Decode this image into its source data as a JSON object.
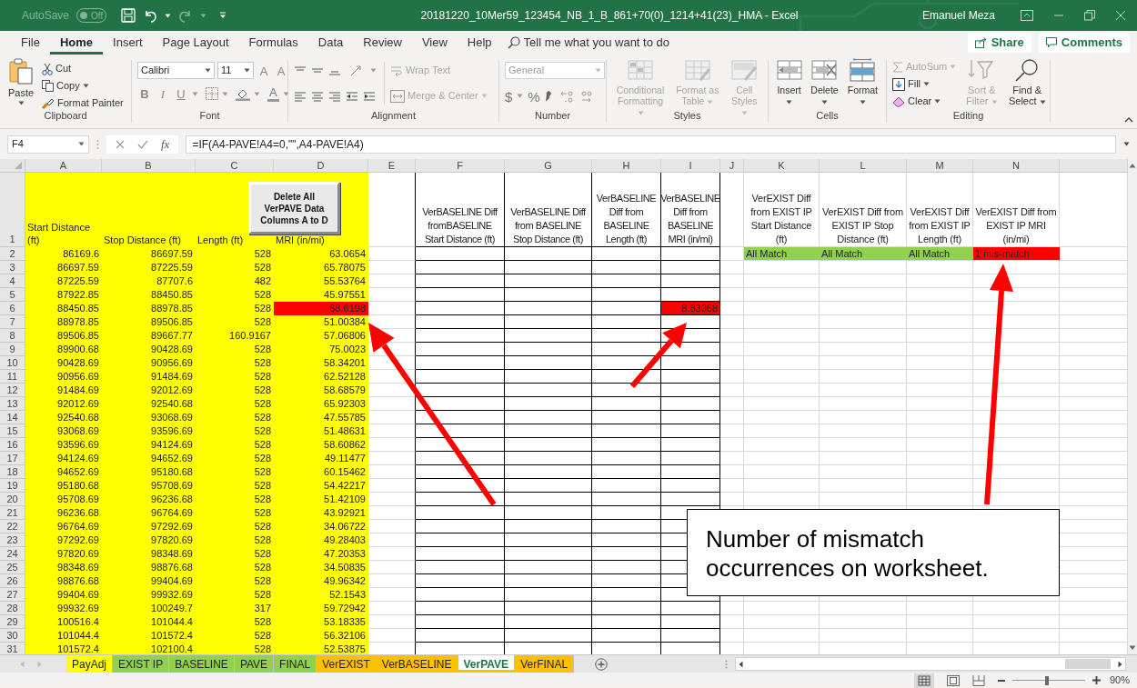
{
  "title_bar": {
    "autosave_label": "AutoSave",
    "autosave_state": "Off",
    "autosave_on": false,
    "document_title": "20181220_10Mer59_123454_NB_1_B_861+70(0)_1214+41(23)_HMA  -  Excel",
    "user": "Emanuel Meza"
  },
  "menu_tabs": [
    {
      "label": "File",
      "selected": false
    },
    {
      "label": "Home",
      "selected": true
    },
    {
      "label": "Insert",
      "selected": false
    },
    {
      "label": "Page Layout",
      "selected": false
    },
    {
      "label": "Formulas",
      "selected": false
    },
    {
      "label": "Data",
      "selected": false
    },
    {
      "label": "Review",
      "selected": false
    },
    {
      "label": "View",
      "selected": false
    },
    {
      "label": "Help",
      "selected": false
    }
  ],
  "tell_me": {
    "placeholder": "Tell me what you want to do"
  },
  "share": "Share",
  "comments": "Comments",
  "ribbon": [
    {
      "kind": "clipboard",
      "label": "Clipboard",
      "paste": "Paste",
      "cut": "Cut",
      "copy": "Copy",
      "format_painter": "Format Painter"
    },
    {
      "kind": "font",
      "label": "Font",
      "font_name": "Calibri",
      "font_size": "11",
      "grow": "A",
      "shrink": "A",
      "bold": "B",
      "italic": "I",
      "underline": "U",
      "font_color": "A"
    },
    {
      "kind": "alignment",
      "label": "Alignment",
      "items": [
        {
          "label": "Wrap Text",
          "disabled": true
        },
        {
          "label": "Merge & Center",
          "disabled": true
        }
      ]
    },
    {
      "kind": "number",
      "label": "Number",
      "format": "General",
      "currency": "$",
      "percent": "%"
    },
    {
      "kind": "large",
      "label": "Styles",
      "items": [
        {
          "kind": "conditional",
          "label": "Conditional Formatting",
          "disabled": true
        },
        {
          "kind": "table",
          "label": "Format as Table",
          "disabled": true
        },
        {
          "kind": "cellstyles",
          "label": "Cell Styles",
          "disabled": true
        }
      ]
    },
    {
      "kind": "large",
      "label": "Cells",
      "items": [
        {
          "kind": "insert",
          "label": "Insert",
          "disabled": false
        },
        {
          "kind": "delete",
          "label": "Delete",
          "disabled": false
        },
        {
          "kind": "format",
          "label": "Format",
          "disabled": false
        }
      ]
    },
    {
      "kind": "editing",
      "label": "Editing",
      "items": [
        {
          "kind": "autosum",
          "label": "AutoSum",
          "disabled": true
        },
        {
          "kind": "fill",
          "label": "Fill",
          "disabled": false
        },
        {
          "kind": "clear",
          "label": "Clear",
          "disabled": false
        },
        {
          "kind": "sort",
          "label": "Sort & Filter",
          "disabled": true
        },
        {
          "kind": "find",
          "label": "Find & Select",
          "disabled": false
        }
      ]
    }
  ],
  "formula_bar": {
    "name_box": "F4",
    "function_label": "fx",
    "formula": "=IF(A4-PAVE!A4=0,\"\",A4-PAVE!A4)"
  },
  "columns": [
    "A",
    "B",
    "C",
    "D",
    "E",
    "F",
    "G",
    "H",
    "I",
    "J",
    "K",
    "L",
    "M",
    "N"
  ],
  "header_row": "1",
  "data_headers": [
    "Start Distance (ft)",
    "Stop Distance (ft)",
    "Length (ft)",
    "MRI (in/mi)"
  ],
  "baseline_diff_headers": [
    "VerBASELINE Diff fromBASELINE Start Distance (ft)",
    "VerBASELINE Diff from BASELINE Stop Distance (ft)",
    "VerBASELINE Diff from BASELINE Length (ft)",
    "VerBASELINE Diff from BASELINE MRI (in/mi)"
  ],
  "exist_diff_headers": [
    "VerEXIST Diff from EXIST IP Start Distance (ft)",
    "VerEXIST Diff from EXIST IP Stop Distance (ft)",
    "VerEXIST Diff from EXIST IP Length (ft)",
    "VerEXIST Diff from EXIST IP MRI (in/mi)"
  ],
  "delete_button": "Delete All VerPAVE Data Columns A to D",
  "rows": [
    {
      "row": "2",
      "values": [
        "86169.6",
        "86697.59",
        "528",
        "63.0654"
      ],
      "mri_mismatch": false,
      "exist_ip_diffs": [
        {
          "text": "All Match",
          "match": true
        },
        {
          "text": "All Match",
          "match": true
        },
        {
          "text": "All Match",
          "match": true
        },
        {
          "text": "1 mis-match",
          "match": false
        }
      ]
    },
    {
      "row": "3",
      "values": [
        "86697.59",
        "87225.59",
        "528",
        "65.78075"
      ],
      "mri_mismatch": false
    },
    {
      "row": "4",
      "values": [
        "87225.59",
        "87707.6",
        "482",
        "55.53764"
      ],
      "mri_mismatch": false
    },
    {
      "row": "5",
      "values": [
        "87922.85",
        "88450.85",
        "528",
        "45.97551"
      ],
      "mri_mismatch": false
    },
    {
      "row": "6",
      "values": [
        "88450.85",
        "88978.85",
        "528",
        "68.6198"
      ],
      "mri_mismatch": true,
      "baseline_mri_diff": "8.83068"
    },
    {
      "row": "7",
      "values": [
        "88978.85",
        "89506.85",
        "528",
        "51.00384"
      ],
      "mri_mismatch": false
    },
    {
      "row": "8",
      "values": [
        "89506.85",
        "89667.77",
        "160.9167",
        "57.06806"
      ],
      "mri_mismatch": false
    },
    {
      "row": "9",
      "values": [
        "89900.68",
        "90428.69",
        "528",
        "75.0023"
      ],
      "mri_mismatch": false
    },
    {
      "row": "10",
      "values": [
        "90428.69",
        "90956.69",
        "528",
        "58.34201"
      ],
      "mri_mismatch": false
    },
    {
      "row": "11",
      "values": [
        "90956.69",
        "91484.69",
        "528",
        "62.52128"
      ],
      "mri_mismatch": false
    },
    {
      "row": "12",
      "values": [
        "91484.69",
        "92012.69",
        "528",
        "58.68579"
      ],
      "mri_mismatch": false
    },
    {
      "row": "13",
      "values": [
        "92012.69",
        "92540.68",
        "528",
        "65.92303"
      ],
      "mri_mismatch": false
    },
    {
      "row": "14",
      "values": [
        "92540.68",
        "93068.69",
        "528",
        "47.55785"
      ],
      "mri_mismatch": false
    },
    {
      "row": "15",
      "values": [
        "93068.69",
        "93596.69",
        "528",
        "51.48631"
      ],
      "mri_mismatch": false
    },
    {
      "row": "16",
      "values": [
        "93596.69",
        "94124.69",
        "528",
        "58.60862"
      ],
      "mri_mismatch": false
    },
    {
      "row": "17",
      "values": [
        "94124.69",
        "94652.69",
        "528",
        "49.11477"
      ],
      "mri_mismatch": false
    },
    {
      "row": "18",
      "values": [
        "94652.69",
        "95180.68",
        "528",
        "60.15462"
      ],
      "mri_mismatch": false
    },
    {
      "row": "19",
      "values": [
        "95180.68",
        "95708.69",
        "528",
        "54.42217"
      ],
      "mri_mismatch": false
    },
    {
      "row": "20",
      "values": [
        "95708.69",
        "96236.68",
        "528",
        "51.42109"
      ],
      "mri_mismatch": false
    },
    {
      "row": "21",
      "values": [
        "96236.68",
        "96764.69",
        "528",
        "43.92921"
      ],
      "mri_mismatch": false
    },
    {
      "row": "22",
      "values": [
        "96764.69",
        "97292.69",
        "528",
        "34.06722"
      ],
      "mri_mismatch": false
    },
    {
      "row": "23",
      "values": [
        "97292.69",
        "97820.69",
        "528",
        "49.28403"
      ],
      "mri_mismatch": false
    },
    {
      "row": "24",
      "values": [
        "97820.69",
        "98348.69",
        "528",
        "47.20353"
      ],
      "mri_mismatch": false
    },
    {
      "row": "25",
      "values": [
        "98348.69",
        "98876.68",
        "528",
        "34.50835"
      ],
      "mri_mismatch": false
    },
    {
      "row": "26",
      "values": [
        "98876.68",
        "99404.69",
        "528",
        "49.96342"
      ],
      "mri_mismatch": false
    },
    {
      "row": "27",
      "values": [
        "99404.69",
        "99932.69",
        "528",
        "52.1543"
      ],
      "mri_mismatch": false
    },
    {
      "row": "28",
      "values": [
        "99932.69",
        "100249.7",
        "317",
        "59.72942"
      ],
      "mri_mismatch": false
    },
    {
      "row": "29",
      "values": [
        "100516.4",
        "101044.4",
        "528",
        "53.18335"
      ],
      "mri_mismatch": false
    },
    {
      "row": "30",
      "values": [
        "101044.4",
        "101572.4",
        "528",
        "56.32106"
      ],
      "mri_mismatch": false
    },
    {
      "row": "31",
      "values": [
        "101572.4",
        "102100.4",
        "528",
        "52.53875"
      ],
      "mri_mismatch": false
    }
  ],
  "sheet_tabs": [
    {
      "label": "PayAdj",
      "color": "#ffff00",
      "selected": false
    },
    {
      "label": "EXIST IP",
      "color": "#92d050",
      "selected": false
    },
    {
      "label": "BASELINE",
      "color": "#92d050",
      "selected": false
    },
    {
      "label": "PAVE",
      "color": "#92d050",
      "selected": false
    },
    {
      "label": "FINAL",
      "color": "#92d050",
      "selected": false
    },
    {
      "label": "VerEXIST",
      "color": "#ffc000",
      "selected": false
    },
    {
      "label": "VerBASELINE",
      "color": "#ffc000",
      "selected": false
    },
    {
      "label": "VerPAVE",
      "color": "#ffc000",
      "selected": true
    },
    {
      "label": "VerFINAL",
      "color": "#ffc000",
      "selected": false
    }
  ],
  "zoom": {
    "level": 0.47,
    "reading": "90%"
  },
  "callout": "Number of mismatch occurrences on worksheet."
}
